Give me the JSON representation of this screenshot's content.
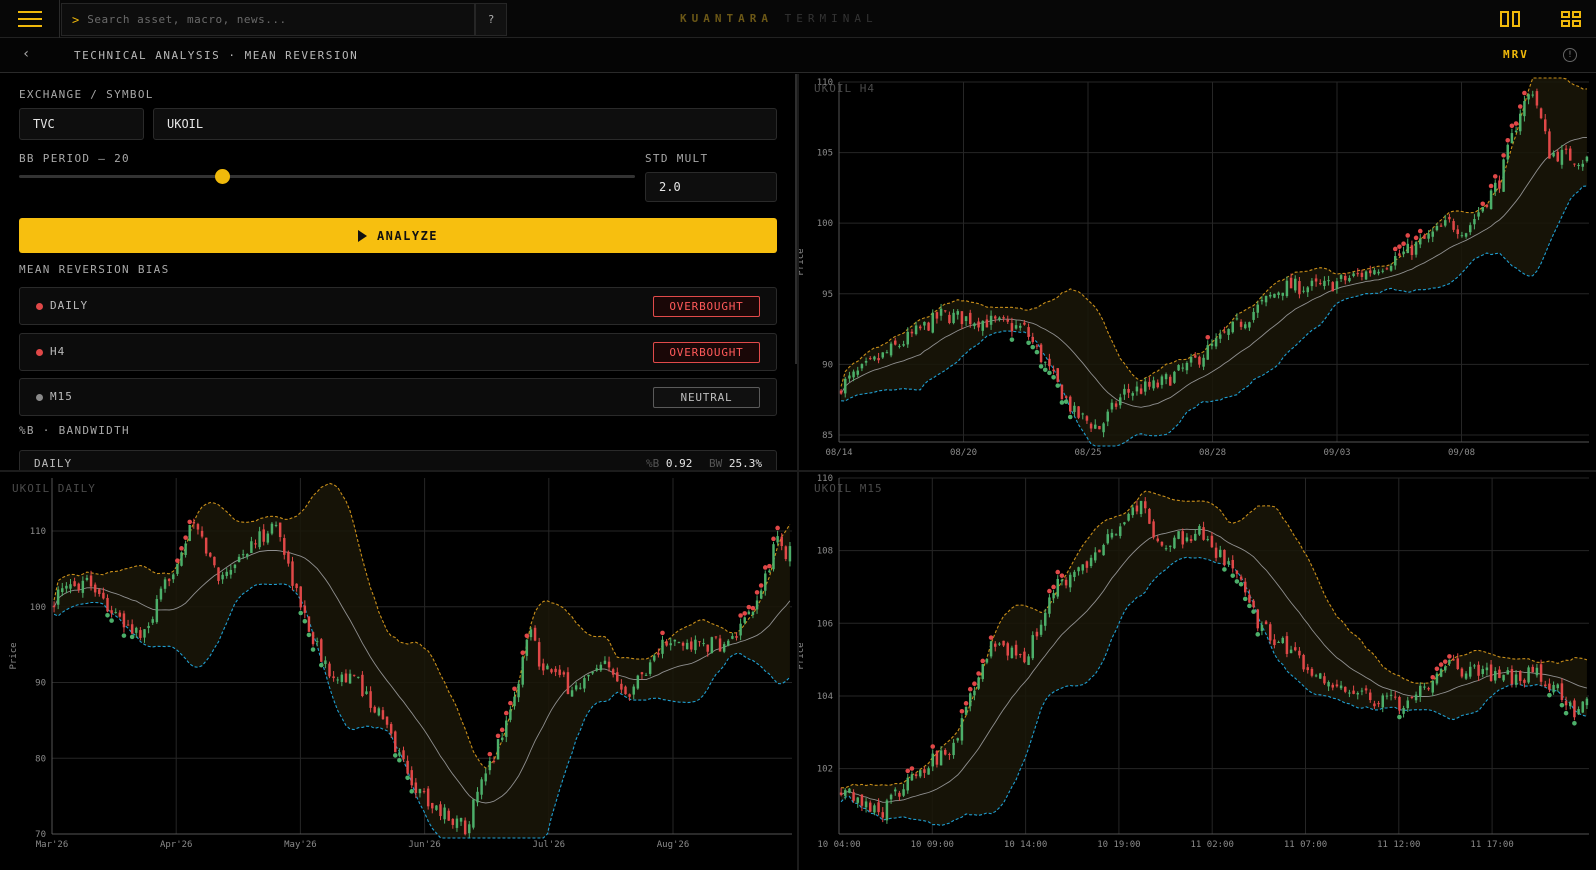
{
  "topbar": {
    "search_prompt": ">",
    "search_placeholder": "Search asset, macro, news...",
    "help_label": "?",
    "brand_primary": "KUANTARA",
    "brand_secondary": "TERMINAL"
  },
  "subbar": {
    "back_label": "‹",
    "title": "TECHNICAL ANALYSIS · MEAN REVERSION",
    "badge": "MRV",
    "info_label": "!"
  },
  "form": {
    "exchange_symbol_label": "EXCHANGE / SYMBOL",
    "exchange_value": "TVC",
    "symbol_value": "UKOIL",
    "bb_period_label": "BB PERIOD — 20",
    "bb_period": 20,
    "bb_period_fraction": 0.33,
    "std_mult_label": "STD MULT",
    "std_mult_value": "2.0",
    "analyze_label": "ANALYZE"
  },
  "bias": {
    "section_label": "MEAN REVERSION BIAS",
    "rows": [
      {
        "tf": "DAILY",
        "status": "OVERBOUGHT",
        "kind": "ob"
      },
      {
        "tf": "H4",
        "status": "OVERBOUGHT",
        "kind": "ob"
      },
      {
        "tf": "M15",
        "status": "NEUTRAL",
        "kind": "neu"
      }
    ]
  },
  "bandwidth": {
    "section_label": "%B · BANDWIDTH",
    "row_tf": "DAILY",
    "pb_key": "%B",
    "pb_value": "0.92",
    "bw_key": "BW",
    "bw_value": "25.3%"
  },
  "colors": {
    "accent": "#f0b90b",
    "bull": "#4caf6a",
    "bear": "#e04848",
    "upper_band": "#c98f1a",
    "lower_band": "#1f9ed0",
    "mid_band": "#8f8f8f"
  },
  "charts": {
    "h4": {
      "title": "UKOIL H4",
      "y_axis_title": "Price",
      "y_ticks": [
        85,
        90,
        95,
        100,
        105,
        110
      ],
      "ylim": [
        84.5,
        110
      ],
      "x_ticks": [
        "08/14",
        "08/20",
        "08/25",
        "08/28",
        "09/03",
        "09/08"
      ]
    },
    "daily": {
      "title": "UKOIL DAILY",
      "y_axis_title": "Price",
      "y_ticks": [
        70,
        80,
        90,
        100,
        110
      ],
      "ylim": [
        70,
        117
      ],
      "x_ticks": [
        "Mar'26",
        "Apr'26",
        "May'26",
        "Jun'26",
        "Jul'26",
        "Aug'26"
      ]
    },
    "m15": {
      "title": "UKOIL M15",
      "y_axis_title": "Price",
      "y_ticks": [
        102,
        104,
        106,
        108,
        110
      ],
      "ylim": [
        100.2,
        110
      ],
      "x_ticks": [
        "10 04:00",
        "10 09:00",
        "10 14:00",
        "10 19:00",
        "11 02:00",
        "11 07:00",
        "11 12:00",
        "11 17:00"
      ]
    }
  },
  "chart_data": [
    {
      "type": "candlestick",
      "title": "UKOIL H4",
      "ylabel": "Price",
      "ylim": [
        84.5,
        110
      ],
      "x_ticks": [
        "08/14",
        "08/20",
        "08/25",
        "08/28",
        "09/03",
        "09/08"
      ],
      "close_keyframes": [
        [
          0,
          88.5
        ],
        [
          12,
          91
        ],
        [
          24,
          93.5
        ],
        [
          36,
          93
        ],
        [
          44,
          92.5
        ],
        [
          48,
          90.5
        ],
        [
          56,
          86.5
        ],
        [
          62,
          85.5
        ],
        [
          68,
          88
        ],
        [
          76,
          88.5
        ],
        [
          84,
          90
        ],
        [
          96,
          93
        ],
        [
          106,
          95.5
        ],
        [
          116,
          95.5
        ],
        [
          126,
          96.5
        ],
        [
          136,
          98
        ],
        [
          146,
          100
        ],
        [
          150,
          99.5
        ],
        [
          158,
          103
        ],
        [
          163,
          108
        ],
        [
          166,
          109.5
        ],
        [
          170,
          105
        ],
        [
          178,
          104.5
        ]
      ],
      "bollinger": {
        "period": 20,
        "std_mult": 2.0
      }
    },
    {
      "type": "candlestick",
      "title": "UKOIL DAILY",
      "ylabel": "Price",
      "ylim": [
        70,
        117
      ],
      "x_ticks": [
        "Mar'26",
        "Apr'26",
        "May'26",
        "Jun'26",
        "Jul'26",
        "Aug'26"
      ],
      "close_keyframes": [
        [
          0,
          101
        ],
        [
          8,
          104
        ],
        [
          16,
          98
        ],
        [
          22,
          96
        ],
        [
          28,
          104
        ],
        [
          34,
          111
        ],
        [
          40,
          104
        ],
        [
          48,
          108
        ],
        [
          54,
          111
        ],
        [
          60,
          100
        ],
        [
          66,
          92
        ],
        [
          74,
          90
        ],
        [
          80,
          85
        ],
        [
          88,
          76
        ],
        [
          94,
          73
        ],
        [
          100,
          71
        ],
        [
          106,
          79
        ],
        [
          112,
          88
        ],
        [
          116,
          98
        ],
        [
          118,
          93
        ],
        [
          126,
          89
        ],
        [
          134,
          92
        ],
        [
          140,
          89
        ],
        [
          148,
          95
        ],
        [
          156,
          95
        ],
        [
          164,
          95
        ],
        [
          170,
          99
        ],
        [
          176,
          109
        ],
        [
          178,
          107
        ]
      ],
      "bollinger": {
        "period": 20,
        "std_mult": 2.0
      }
    },
    {
      "type": "candlestick",
      "title": "UKOIL M15",
      "ylabel": "Price",
      "ylim": [
        100.2,
        110
      ],
      "x_ticks": [
        "10 04:00",
        "10 09:00",
        "10 14:00",
        "10 19:00",
        "11 02:00",
        "11 07:00",
        "11 12:00",
        "11 17:00"
      ],
      "close_keyframes": [
        [
          0,
          101.5
        ],
        [
          10,
          100.8
        ],
        [
          18,
          102
        ],
        [
          26,
          102.4
        ],
        [
          36,
          105.5
        ],
        [
          44,
          105
        ],
        [
          52,
          107
        ],
        [
          58,
          107.5
        ],
        [
          66,
          108.6
        ],
        [
          72,
          109.4
        ],
        [
          76,
          108.2
        ],
        [
          86,
          108.5
        ],
        [
          94,
          107.5
        ],
        [
          100,
          106
        ],
        [
          108,
          105.2
        ],
        [
          116,
          104.5
        ],
        [
          124,
          104
        ],
        [
          134,
          103.8
        ],
        [
          146,
          104.8
        ],
        [
          158,
          104.5
        ],
        [
          168,
          104.6
        ],
        [
          176,
          103.6
        ],
        [
          179,
          104.1
        ]
      ],
      "bollinger": {
        "period": 20,
        "std_mult": 2.0
      }
    }
  ]
}
